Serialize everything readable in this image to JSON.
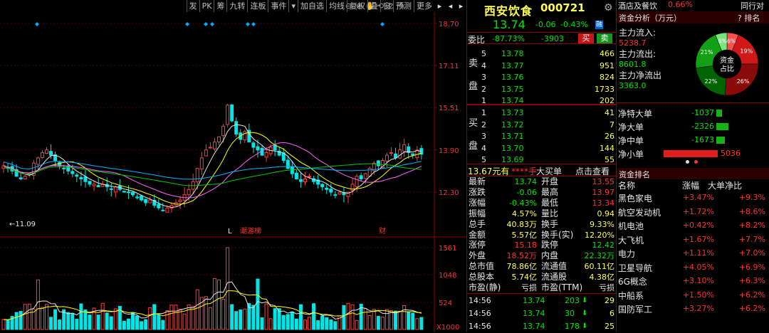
{
  "toolbar": {
    "buttons": [
      "发",
      "PK",
      "筹",
      "九转",
      "连板",
      "事件",
      "▾",
      "加自选",
      "均线",
      "复权",
      "叠",
      "窗",
      "预测",
      "更多"
    ],
    "icons": [
      "⊖",
      "⊕",
      "✋",
      "⟲",
      "⊘",
      "✎"
    ],
    "arrows": [
      "▸",
      "◂",
      "▸"
    ]
  },
  "chart": {
    "price_ticks": [
      "18.70",
      "17.11",
      "15.51",
      "13.90",
      "12.30"
    ],
    "low_label": "11.09",
    "markers": [
      "L",
      "潮游榜",
      "财"
    ],
    "volume_ticks": [
      "1561",
      "1048",
      "524"
    ],
    "volume_unit": "X1000",
    "colors": {
      "up": "#ff3c3c",
      "down": "#00e6e6",
      "ma5": "#e6e6e6",
      "ma10": "#ffff00",
      "ma20": "#ff64ff",
      "ma60": "#00c800",
      "ma120": "#00b4ff"
    }
  },
  "quote": {
    "name": "西安饮食",
    "code": "000721",
    "price": "13.74",
    "change": "-0.06",
    "change_pct": "-0.43%",
    "tag": "融",
    "weibi_label": "委比",
    "weibi_pct": "-87.73%",
    "weibi_diff": "-3903",
    "buy_btn": "买",
    "sell_btn": "卖",
    "sell_label": "卖盘",
    "buy_label": "买盘",
    "asks": [
      {
        "lvl": "5",
        "price": "13.78",
        "vol": "466"
      },
      {
        "lvl": "4",
        "price": "13.77",
        "vol": "951"
      },
      {
        "lvl": "3",
        "price": "13.76",
        "vol": "824"
      },
      {
        "lvl": "2",
        "price": "13.75",
        "vol": "1733"
      },
      {
        "lvl": "1",
        "price": "13.74",
        "vol": "202"
      }
    ],
    "bids": [
      {
        "lvl": "1",
        "price": "13.73",
        "vol": "41"
      },
      {
        "lvl": "2",
        "price": "13.72",
        "vol": "7"
      },
      {
        "lvl": "3",
        "price": "13.71",
        "vol": "26"
      },
      {
        "lvl": "4",
        "price": "13.70",
        "vol": "144"
      },
      {
        "lvl": "5",
        "price": "13.69",
        "vol": "55"
      }
    ],
    "bigbuy": {
      "price": "13.67元有",
      "mask": "****手",
      "label": "大买单",
      "link": "点击查看"
    },
    "stats": [
      {
        "l1": "最新",
        "v1": "13.74",
        "l2": "开盘",
        "v2": "13.55"
      },
      {
        "l1": "涨跌",
        "v1": "-0.06",
        "l2": "最高",
        "v2": "13.97"
      },
      {
        "l1": "涨幅",
        "v1": "-0.43%",
        "l2": "最低",
        "v2": "13.34"
      },
      {
        "l1": "振幅",
        "v1": "4.57%",
        "l2": "量比",
        "v2": "0.94"
      },
      {
        "l1": "总手",
        "v1": "40.83万",
        "l2": "换手",
        "v2": "9.33%"
      },
      {
        "l1": "金额",
        "v1": "5.57亿",
        "l2": "换手(实)",
        "v2": "12.20%"
      },
      {
        "l1": "涨停",
        "v1": "15.18",
        "l2": "跌停",
        "v2": "12.42"
      },
      {
        "l1": "外盘",
        "v1": "18.52万",
        "l2": "内盘",
        "v2": "22.32万"
      },
      {
        "l1": "总市值",
        "v1": "78.86亿",
        "l2": "流通值",
        "v2": "60.11亿"
      },
      {
        "l1": "总股本",
        "v1": "5.74亿",
        "l2": "流通股",
        "v2": "4.38亿"
      },
      {
        "l1": "市盈(静)",
        "v1": "亏损",
        "l2": "市盈(TTM)",
        "v2": "亏损"
      }
    ],
    "ticks": [
      {
        "time": "14:56",
        "price": "13.74",
        "vol": "203",
        "n": "29"
      },
      {
        "time": "14:56",
        "price": "13.74",
        "vol": "30",
        "n": "6"
      },
      {
        "time": "14:56",
        "price": "13.74",
        "vol": "178",
        "n": "25"
      }
    ]
  },
  "fund": {
    "sector": "酒店及餐饮",
    "sector_pct": "0.66%",
    "compare": "同行对比",
    "title": "资金分析（万元）",
    "rank_link": "? 排名",
    "inflow_label": "主力流入:",
    "inflow": "5238.7",
    "outflow_label": "主力流出:",
    "outflow": "8601.8",
    "net_label": "主力净流出",
    "net": "3363.0",
    "pie_center": [
      "资金",
      "占比"
    ],
    "pie": [
      {
        "label": "6%",
        "value": 6,
        "color": "#ff5050"
      },
      {
        "label": "19%",
        "value": 19,
        "color": "#d01818"
      },
      {
        "label": "26%",
        "value": 26,
        "color": "#8b0a0a"
      },
      {
        "label": "22%",
        "value": 22,
        "color": "#006400"
      },
      {
        "label": "21%",
        "value": 21,
        "color": "#14a014"
      },
      {
        "label": "6%",
        "value": 6,
        "color": "#78e678"
      }
    ],
    "net_rows": [
      {
        "label": "净特大单",
        "value": "-1037",
        "pct": 0.21,
        "color": "#14b414"
      },
      {
        "label": "净大单",
        "value": "-2326",
        "pct": 0.46,
        "color": "#14b414"
      },
      {
        "label": "净中单",
        "value": "-1673",
        "pct": 0.33,
        "color": "#14b414"
      },
      {
        "label": "净小单",
        "value": "5036",
        "pct": 1.0,
        "color": "#e01e1e"
      }
    ],
    "rank_title": "资金排名",
    "rank_headers": [
      "名称",
      "涨幅",
      "大单净比"
    ],
    "ranks": [
      {
        "name": "黑色家电",
        "chg": "+3.47%",
        "ratio": "+9.3%"
      },
      {
        "name": "航空发动机",
        "chg": "+1.72%",
        "ratio": "+8.6%"
      },
      {
        "name": "机电池",
        "chg": "+0.42%",
        "ratio": "+8.2%"
      },
      {
        "name": "大飞机",
        "chg": "+1.67%",
        "ratio": "+7.7%"
      },
      {
        "name": "电力",
        "chg": "+1.11%",
        "ratio": "+7.0%"
      },
      {
        "name": "卫星导航",
        "chg": "+4.05%",
        "ratio": "+6.9%"
      },
      {
        "name": "6G概念",
        "chg": "+3.10%",
        "ratio": "+6.3%"
      },
      {
        "name": "中船系",
        "chg": "+1.50%",
        "ratio": "+6.2%"
      },
      {
        "name": "国防军工",
        "chg": "+3.27%",
        "ratio": "+6.2%"
      }
    ]
  }
}
